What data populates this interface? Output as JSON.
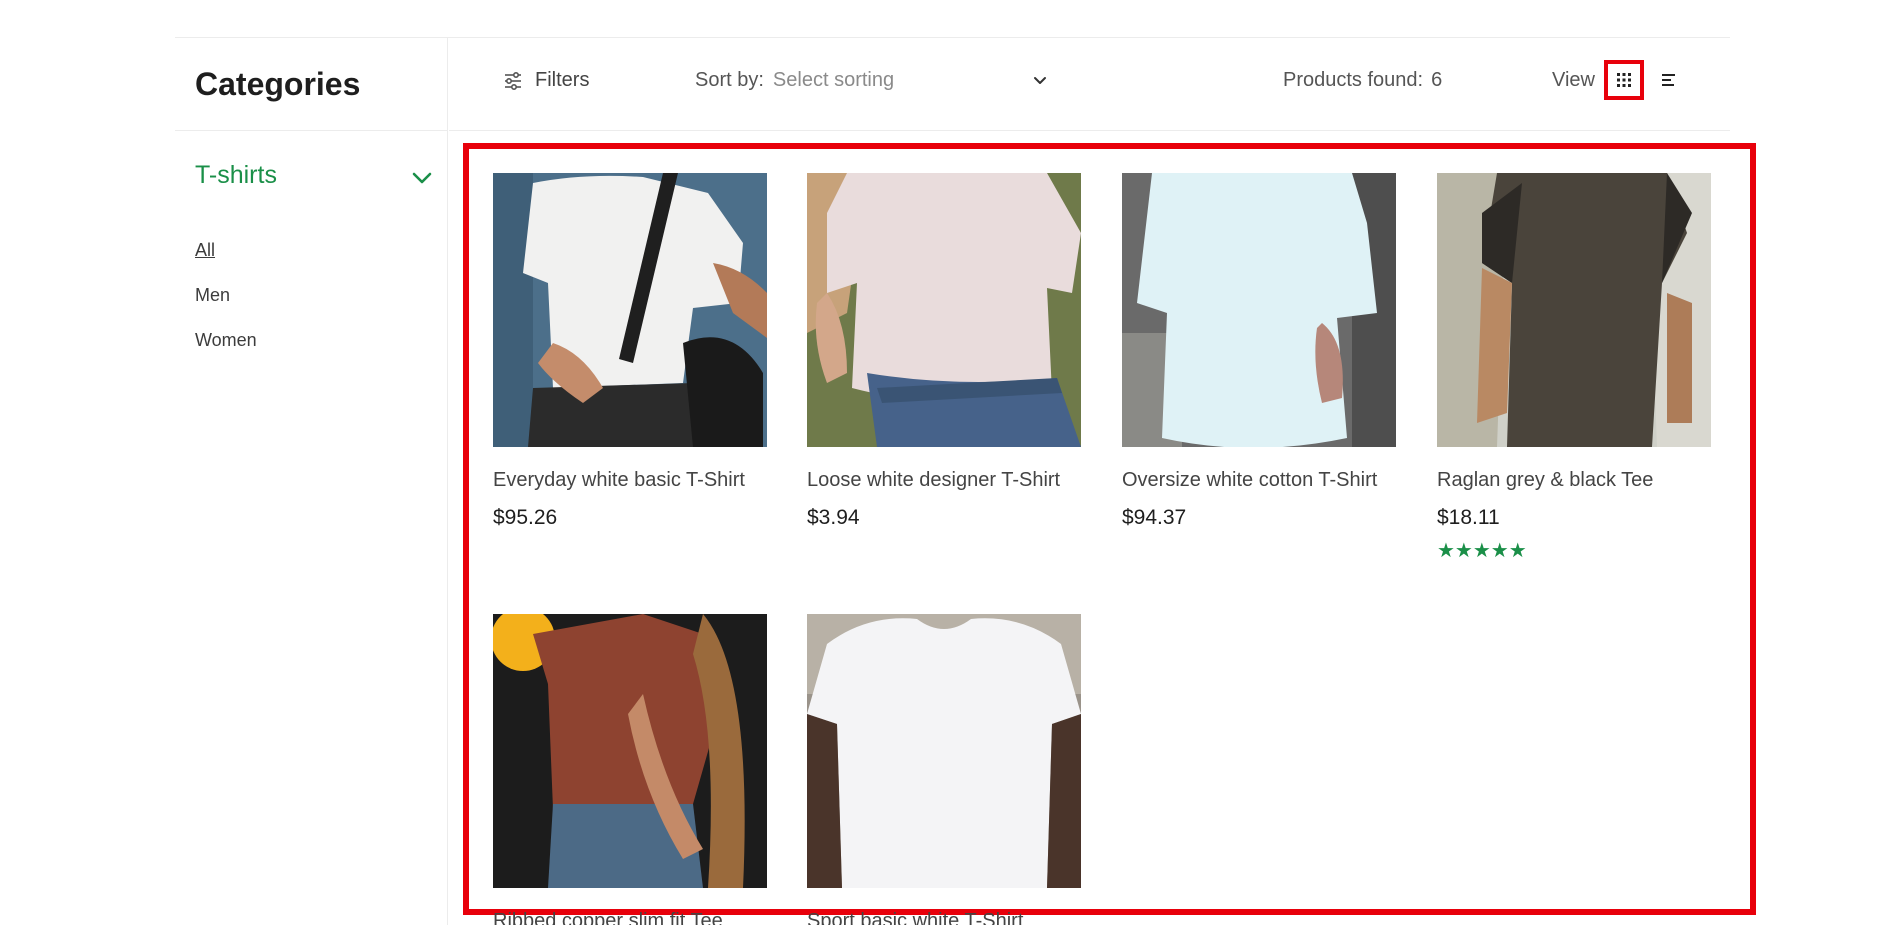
{
  "sidebar": {
    "title": "Categories",
    "group": "T-shirts",
    "items": [
      {
        "label": "All",
        "active": true
      },
      {
        "label": "Men",
        "active": false
      },
      {
        "label": "Women",
        "active": false
      }
    ]
  },
  "toolbar": {
    "filters_label": "Filters",
    "sort_label": "Sort by:",
    "sort_value": "Select sorting",
    "found_label": "Products found:",
    "found_count": "6",
    "view_label": "View"
  },
  "products": [
    {
      "name": "Everyday white basic T-Shirt",
      "price": "$95.26",
      "stars": ""
    },
    {
      "name": "Loose white designer T-Shirt",
      "price": "$3.94",
      "stars": ""
    },
    {
      "name": "Oversize white cotton T-Shirt",
      "price": "$94.37",
      "stars": ""
    },
    {
      "name": "Raglan grey & black Tee",
      "price": "$18.11",
      "stars": "★★★★★",
      "rating": 5
    },
    {
      "name": "Ribbed copper slim fit Tee",
      "price": "",
      "stars": ""
    },
    {
      "name": "Sport basic white T-Shirt",
      "price": "",
      "stars": ""
    }
  ],
  "colors": {
    "accent_green": "#1a8f48",
    "highlight_red": "#e8000b"
  }
}
